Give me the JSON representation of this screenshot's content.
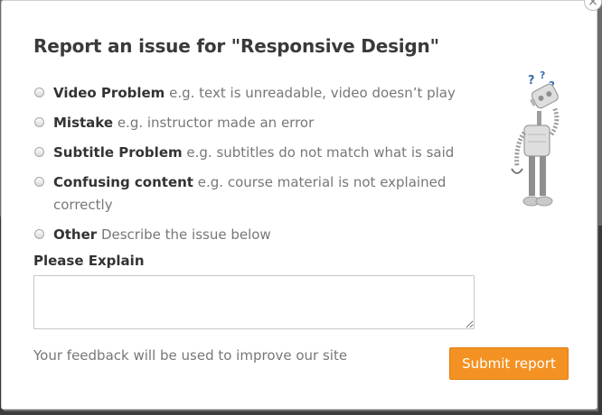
{
  "dialog": {
    "title": "Report an issue for \"Responsive Design\"",
    "close_symbol": "×"
  },
  "options": [
    {
      "label": "Video Problem",
      "hint": "e.g. text is unreadable, video doesn’t play",
      "selected": false
    },
    {
      "label": "Mistake",
      "hint": "e.g. instructor made an error",
      "selected": false
    },
    {
      "label": "Subtitle Problem",
      "hint": "e.g. subtitles do not match what is said",
      "selected": false
    },
    {
      "label": "Confusing content",
      "hint": "e.g. course material is not explained correctly",
      "selected": false
    },
    {
      "label": "Other",
      "hint": "Describe the issue below",
      "selected": false
    }
  ],
  "explain": {
    "label": "Please Explain",
    "value": ""
  },
  "footer": {
    "note": "Your feedback will be used to improve our site",
    "submit_label": "Submit report",
    "accent_color": "#f39223"
  },
  "illustration": {
    "icon": "confused-robot-icon"
  }
}
